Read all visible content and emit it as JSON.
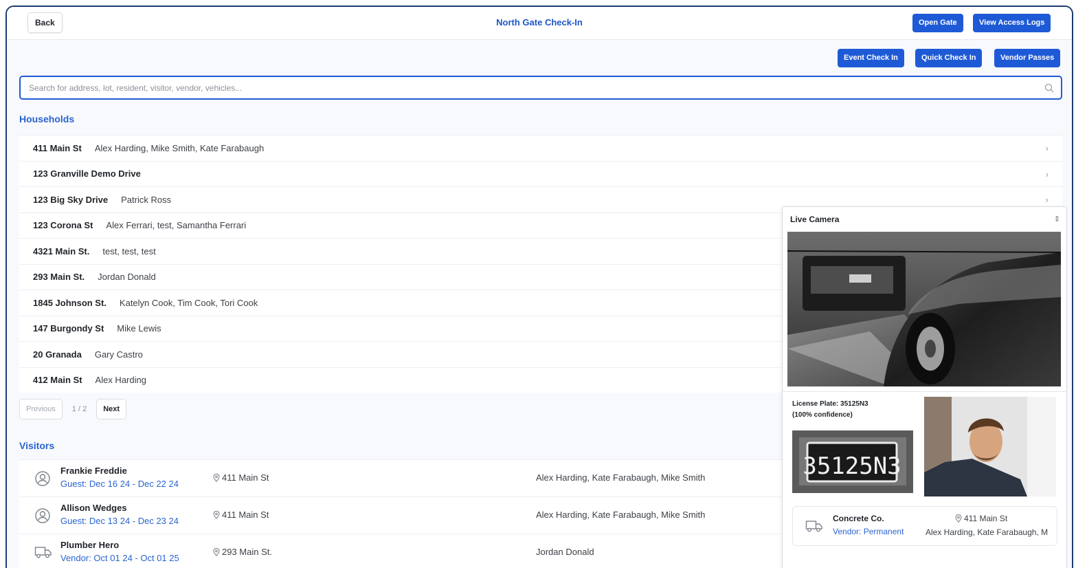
{
  "header": {
    "back_label": "Back",
    "title": "North Gate Check-In",
    "open_gate_label": "Open Gate",
    "access_logs_label": "View Access Logs"
  },
  "actions": {
    "event_check_in": "Event Check In",
    "quick_check_in": "Quick Check In",
    "vendor_passes": "Vendor Passes"
  },
  "search": {
    "placeholder": "Search for address, lot, resident, visitor, vendor, vehicles...",
    "value": ""
  },
  "households": {
    "title": "Households",
    "rows": [
      {
        "address": "411 Main St",
        "residents": "Alex Harding, Mike Smith, Kate Farabaugh"
      },
      {
        "address": "123 Granville Demo Drive",
        "residents": ""
      },
      {
        "address": "123 Big Sky Drive",
        "residents": "Patrick Ross"
      },
      {
        "address": "123 Corona St",
        "residents": "Alex Ferrari, test, Samantha Ferrari"
      },
      {
        "address": "4321 Main St.",
        "residents": "test, test, test"
      },
      {
        "address": "293 Main St.",
        "residents": "Jordan Donald"
      },
      {
        "address": "1845 Johnson St.",
        "residents": "Katelyn Cook, Tim Cook, Tori Cook"
      },
      {
        "address": "147 Burgondy St",
        "residents": "Mike Lewis"
      },
      {
        "address": "20 Granada",
        "residents": "Gary Castro"
      },
      {
        "address": "412 Main St",
        "residents": "Alex Harding"
      }
    ]
  },
  "pagination": {
    "previous": "Previous",
    "page": "1 / 2",
    "next": "Next"
  },
  "visitors": {
    "title": "Visitors",
    "rows": [
      {
        "name": "Frankie Freddie",
        "type": "Guest: Dec 16 24 - Dec 22 24",
        "address": "411 Main St",
        "residents": "Alex Harding, Kate Farabaugh, Mike Smith",
        "icon": "user-circle-icon"
      },
      {
        "name": "Allison Wedges",
        "type": "Guest: Dec 13 24 - Dec 23 24",
        "address": "411 Main St",
        "residents": "Alex Harding, Kate Farabaugh, Mike Smith",
        "icon": "user-circle-icon"
      },
      {
        "name": "Plumber Hero",
        "type": "Vendor: Oct 01 24 - Oct 01 25",
        "address": "293 Main St.",
        "residents": "Jordan Donald",
        "icon": "truck-icon"
      }
    ]
  },
  "camera": {
    "title": "Live Camera",
    "plate_label": "License Plate: 35125N3",
    "confidence_label": "(100% confidence)",
    "plate_text": "35125N3",
    "vendor": {
      "name": "Concrete Co.",
      "type": "Vendor: Permanent",
      "address": "411 Main St",
      "residents": "Alex Harding, Kate Farabaugh, M"
    }
  },
  "colors": {
    "accent": "#1f5ad6",
    "link": "#2a63cf",
    "frame": "#1b3b6f"
  }
}
